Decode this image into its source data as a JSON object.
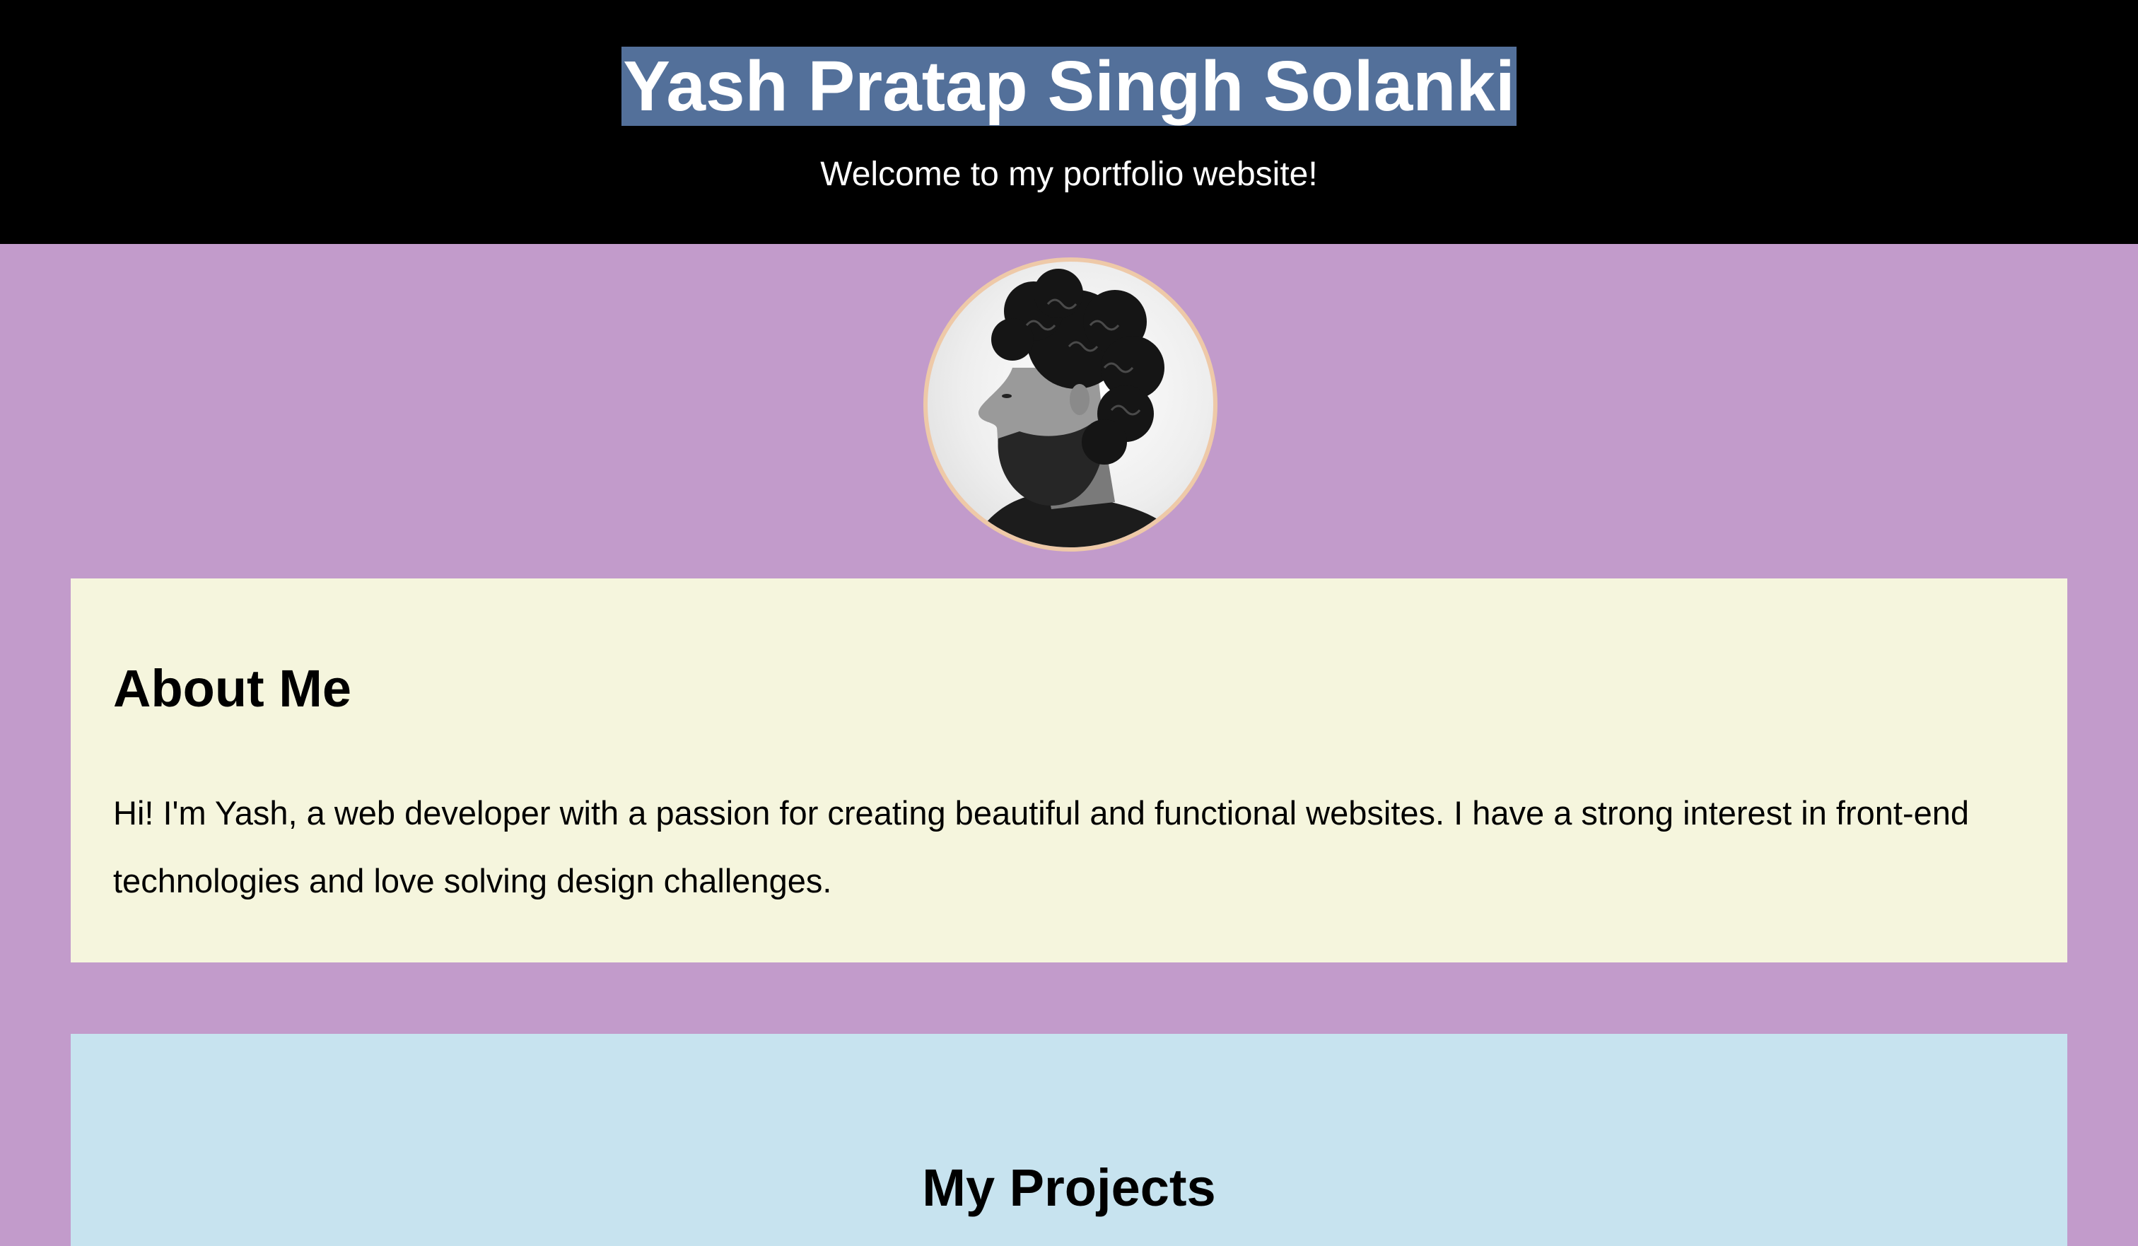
{
  "header": {
    "title": "Yash Pratap Singh Solanki",
    "tagline": "Welcome to my portfolio website!"
  },
  "profile": {
    "image_alt": "Profile photo"
  },
  "about": {
    "heading": "About Me",
    "text": "Hi! I'm Yash, a web developer with a passion for creating beautiful and functional websites. I have a strong interest in front-end technologies and love solving design challenges."
  },
  "projects": {
    "heading": "My Projects"
  },
  "colors": {
    "header_bg": "#000000",
    "page_bg": "#c29bcb",
    "title_highlight": "#53709a",
    "about_bg": "#f5f5dd",
    "projects_bg": "#c7e3ef",
    "avatar_border": "#eec9a8"
  }
}
